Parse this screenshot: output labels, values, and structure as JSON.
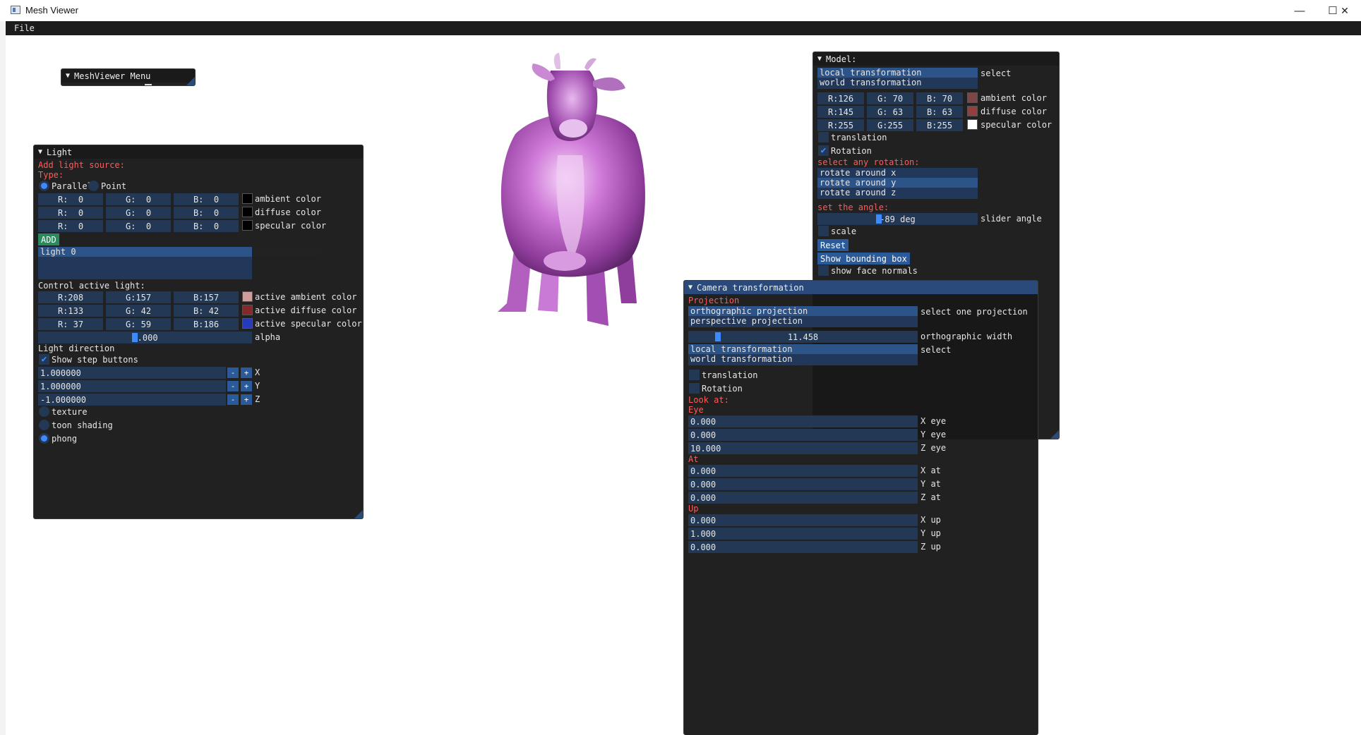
{
  "window": {
    "title": "Mesh Viewer",
    "minimize_glyph": "—",
    "maximize_glyph": "☐",
    "close_glyph": "✕"
  },
  "menubar": {
    "file_label": "File"
  },
  "meshviewer_menu": {
    "title": "MeshViewer Menu"
  },
  "light": {
    "title": "Light",
    "add_source": "Add light source:",
    "type_label": "Type:",
    "parallel_label": "Parallel",
    "point_label": "Point",
    "rows": [
      {
        "r": "R:  0",
        "g": "G:  0",
        "b": "B:  0",
        "label": "ambient color",
        "color": "#000000"
      },
      {
        "r": "R:  0",
        "g": "G:  0",
        "b": "B:  0",
        "label": "diffuse color",
        "color": "#000000"
      },
      {
        "r": "R:  0",
        "g": "G:  0",
        "b": "B:  0",
        "label": "specular color",
        "color": "#000000"
      }
    ],
    "add_button": "ADD",
    "list_items": [
      "light 0"
    ],
    "control_label": "Control active light:",
    "active_rows": [
      {
        "r": "R:208",
        "g": "G:157",
        "b": "B:157",
        "label": "active ambient color",
        "color": "#d09d9d"
      },
      {
        "r": "R:133",
        "g": "G: 42",
        "b": "B: 42",
        "label": "active diffuse color",
        "color": "#852a2a"
      },
      {
        "r": "R: 37",
        "g": "G: 59",
        "b": "B:186",
        "label": "active specular color",
        "color": "#253bba"
      }
    ],
    "alpha_value": "5.000",
    "alpha_label": "alpha",
    "direction_label": "Light direction",
    "show_step_label": "Show step buttons",
    "dir_x": "1.000000",
    "dir_y": "1.000000",
    "dir_z": "-1.000000",
    "x_label": "X",
    "y_label": "Y",
    "z_label": "Z",
    "minus": "-",
    "plus": "+",
    "texture_label": "texture",
    "toon_label": "toon shading",
    "phong_label": "phong"
  },
  "model": {
    "title": "Model:",
    "local_transform": "local transformation",
    "world_transform": "world transformation",
    "select_label": "select",
    "rows": [
      {
        "r": "R:126",
        "g": "G: 70",
        "b": "B: 70",
        "label": "ambient color",
        "color": "#7e4646"
      },
      {
        "r": "R:145",
        "g": "G: 63",
        "b": "B: 63",
        "label": "diffuse color",
        "color": "#913f3f"
      },
      {
        "r": "R:255",
        "g": "G:255",
        "b": "B:255",
        "label": "specular color",
        "color": "#ffffff"
      }
    ],
    "translation_label": "translation",
    "rotation_label": "Rotation",
    "select_rotation": "select any rotation:",
    "rot_x": "rotate around x",
    "rot_y": "rotate around y",
    "rot_z": "rotate around z",
    "set_angle": "set the angle:",
    "angle_value": "-89 deg",
    "slider_angle": "slider angle",
    "scale_label": "scale",
    "reset_button": "Reset",
    "bbox_button": "Show bounding box",
    "face_normals": "show face normals"
  },
  "camera": {
    "title": "Camera transformation",
    "projection_label": "Projection",
    "ortho": "orthographic projection",
    "persp": "perspective projection",
    "select_projection": "select one projection",
    "ortho_width_value": "11.458",
    "ortho_width_label": "orthographic width",
    "local_transform": "local transformation",
    "world_transform": "world transformation",
    "select_label": "select",
    "translation_label": "translation",
    "rotation_label": "Rotation",
    "look_at": "Look at:",
    "eye_label": "Eye",
    "eye": [
      {
        "value": "0.000",
        "label": "X eye"
      },
      {
        "value": "0.000",
        "label": "Y eye"
      },
      {
        "value": "10.000",
        "label": "Z eye"
      }
    ],
    "at_label": "At",
    "at": [
      {
        "value": "0.000",
        "label": "X at"
      },
      {
        "value": "0.000",
        "label": "Y at"
      },
      {
        "value": "0.000",
        "label": "Z at"
      }
    ],
    "up_label": "Up",
    "up": [
      {
        "value": "0.000",
        "label": "X up"
      },
      {
        "value": "1.000",
        "label": "Y up"
      },
      {
        "value": "0.000",
        "label": "Z up"
      }
    ]
  }
}
